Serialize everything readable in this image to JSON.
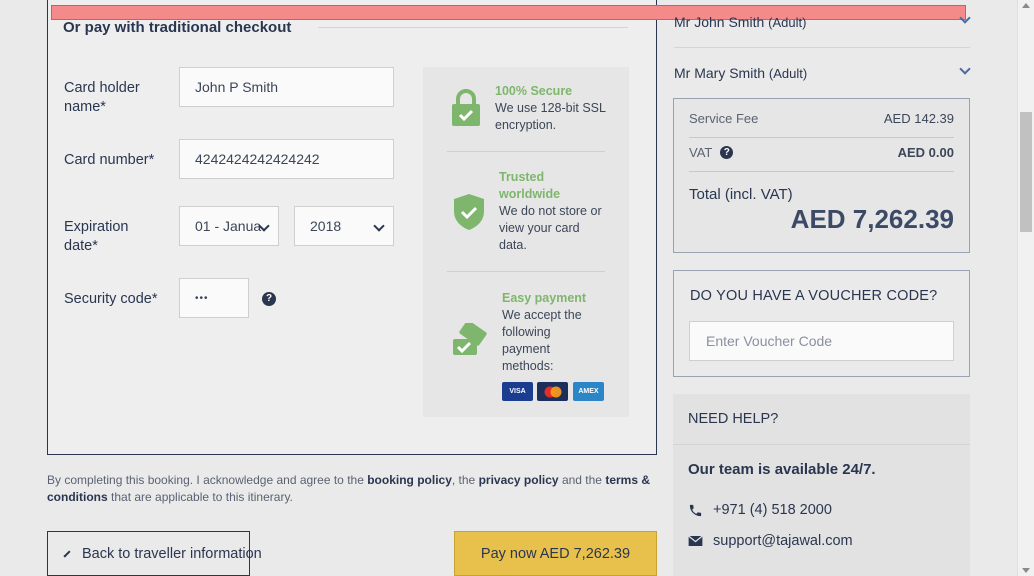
{
  "checkout": {
    "section_title": "Or pay with traditional checkout",
    "cardholder_label_1": "Card holder",
    "cardholder_label_2": "name*",
    "cardholder_value": "John P Smith",
    "card_number_label": "Card number*",
    "card_number_value": "4242424242424242",
    "expiration_label_1": "Expiration",
    "expiration_label_2": "date*",
    "month_value": "01 - Janua",
    "year_value": "2018",
    "security_label": "Security code*",
    "security_value": "•••",
    "help_glyph": "?"
  },
  "trust": {
    "secure_title": "100% Secure",
    "secure_text_1": "We use 128-bit SSL",
    "secure_text_2": "encryption.",
    "trusted_title_1": "Trusted",
    "trusted_title_2": "worldwide",
    "trusted_text_1": "We do not store or",
    "trusted_text_2": "view your card",
    "trusted_text_3": "data.",
    "easy_title": "Easy payment",
    "easy_text_1": "We accept the",
    "easy_text_2": "following",
    "easy_text_3": "payment",
    "easy_text_4": "methods:",
    "cards": [
      "VISA",
      "MC",
      "AMEX"
    ]
  },
  "legal": {
    "part1": "By completing this booking. I acknowledge and agree to the ",
    "booking_policy": "booking policy",
    "part2": ", the ",
    "privacy_policy": "privacy policy",
    "part3": " and the ",
    "terms": "terms & conditions",
    "part4": " that are applicable to this itinerary."
  },
  "buttons": {
    "back_label": "Back to traveller information",
    "pay_label": "Pay now AED 7,262.39"
  },
  "travellers": [
    {
      "name": "Mr John Smith",
      "type": "(Adult)"
    },
    {
      "name": "Mr Mary Smith",
      "type": "(Adult)"
    }
  ],
  "fees": {
    "service_fee_label": "Service Fee",
    "service_fee_value": "AED 142.39",
    "vat_label": "VAT",
    "vat_value": "AED 0.00",
    "total_label": "Total (incl. VAT)",
    "total_value": "AED 7,262.39"
  },
  "voucher": {
    "title": "DO YOU HAVE A VOUCHER CODE?",
    "placeholder": "Enter Voucher Code"
  },
  "help": {
    "title": "NEED HELP?",
    "subtitle": "Our team is available 24/7.",
    "phone": "+971 (4) 518 2000",
    "email": "support@tajawal.com"
  },
  "colors": {
    "accent_green": "#7eb66d",
    "pay_yellow": "#e8c04c",
    "navy": "#2a3650",
    "error_bar": "#f58a8a"
  }
}
